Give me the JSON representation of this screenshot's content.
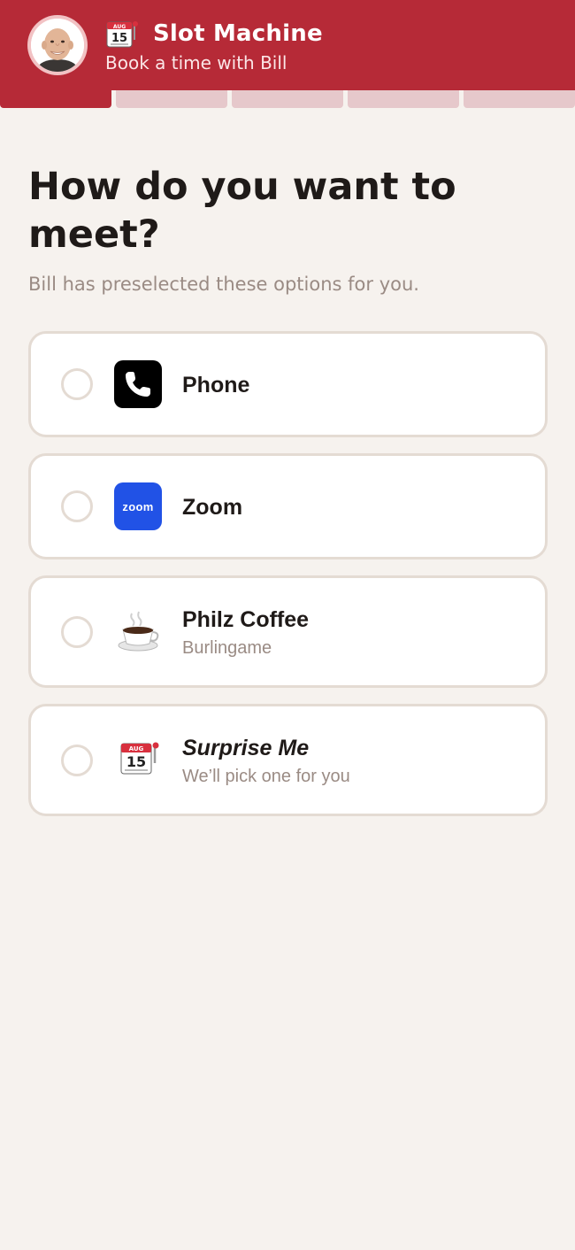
{
  "header": {
    "title": "Slot Machine",
    "subtitle": "Book a time with Bill",
    "brand_color": "#b62a37",
    "app_icon": "slot-machine-calendar-icon"
  },
  "progress": {
    "total_steps": 5,
    "current_step": 1
  },
  "main": {
    "heading": "How do you want to meet?",
    "subheading": "Bill has preselected these options for you."
  },
  "options": [
    {
      "label": "Phone",
      "icon": "phone-icon"
    },
    {
      "label": "Zoom",
      "icon": "zoom-icon",
      "icon_text": "zoom"
    },
    {
      "label": "Philz Coffee",
      "sublabel": "Burlingame",
      "icon": "coffee-cup-icon"
    },
    {
      "label": "Surprise Me",
      "sublabel": "We’ll pick one for you",
      "icon": "slot-machine-calendar-icon",
      "calendar_month": "AUG",
      "calendar_day": "15"
    }
  ]
}
